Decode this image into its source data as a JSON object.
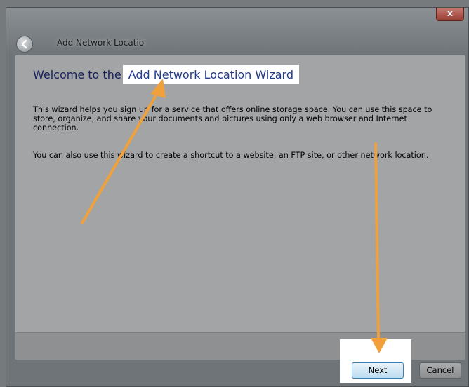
{
  "window": {
    "title": "Add Network Locatio",
    "close_symbol": "x"
  },
  "wizard": {
    "heading_prefix": "Welcome to the",
    "heading_highlight": "Add Network Location Wizard",
    "paragraph1": "This wizard helps you sign up for a service that offers online storage space.  You can use this space to store, organize, and share your documents and pictures using only a web browser and Internet connection.",
    "paragraph2": "You can also use this wizard to create a shortcut to a website, an FTP site, or other network location."
  },
  "buttons": {
    "next": "Next",
    "cancel": "Cancel"
  },
  "colors": {
    "arrow": "#f0a13c",
    "highlight": "#ffffff"
  },
  "icons": {
    "back": "back-arrow-icon",
    "close": "close-icon"
  }
}
